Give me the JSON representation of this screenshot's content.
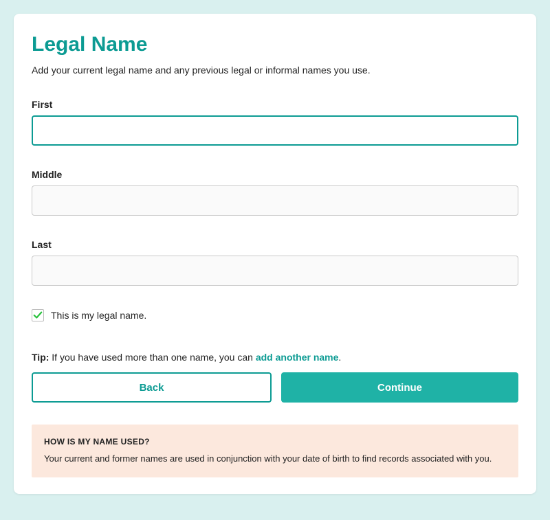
{
  "page": {
    "title": "Legal Name",
    "subtitle": "Add your current legal name and any previous legal or informal names you use."
  },
  "fields": {
    "first": {
      "label": "First",
      "value": ""
    },
    "middle": {
      "label": "Middle",
      "value": ""
    },
    "last": {
      "label": "Last",
      "value": ""
    }
  },
  "legalNameCheckbox": {
    "label": "This is my legal name.",
    "checked": true
  },
  "tip": {
    "label": "Tip:",
    "text": " If you have used more than one name, you can ",
    "linkText": "add another name",
    "suffix": "."
  },
  "buttons": {
    "back": "Back",
    "continue": "Continue"
  },
  "infoBox": {
    "title": "HOW IS MY NAME USED?",
    "text": "Your current and former names are used in conjunction with your date of birth to find records associated with you."
  }
}
